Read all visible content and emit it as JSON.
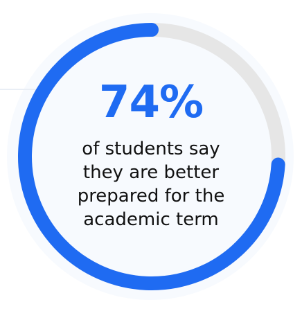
{
  "chart_data": {
    "type": "pie",
    "variant": "donut",
    "value": 74,
    "value_label": "74%",
    "caption_lines": [
      "of students say",
      "they are better",
      "prepared for the",
      "academic term"
    ],
    "colors": {
      "filled": "#1f6bf2",
      "track": "#e6e6e6",
      "text": "#111111"
    }
  }
}
